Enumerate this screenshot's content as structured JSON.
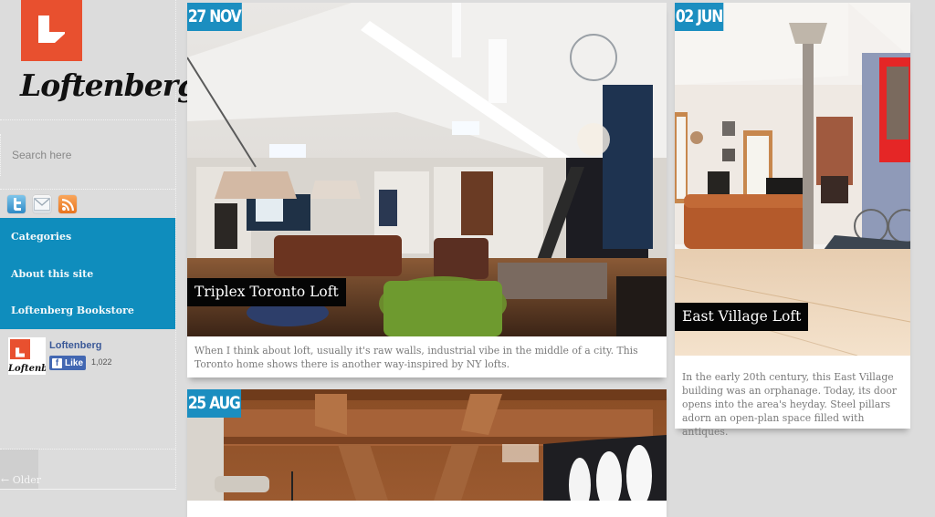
{
  "brand": {
    "name": "Loftenberg",
    "logo_color": "#e8502f",
    "accent_color": "#0f8dbd",
    "date_badge_color": "#1b8ec0"
  },
  "search": {
    "placeholder": "Search here",
    "value": ""
  },
  "social": [
    {
      "name": "twitter",
      "icon": "twitter-icon"
    },
    {
      "name": "email",
      "icon": "mail-icon"
    },
    {
      "name": "rss",
      "icon": "rss-icon"
    }
  ],
  "nav": {
    "items": [
      {
        "label": "Categories"
      },
      {
        "label": "About this site"
      },
      {
        "label": "Loftenberg Bookstore"
      }
    ]
  },
  "facebook": {
    "page_name": "Loftenberg",
    "like_label": "Like",
    "like_count": "1,022",
    "thumb_text": "Loftenberg"
  },
  "pagination": {
    "older_label": "← Older"
  },
  "posts": [
    {
      "date": "27 NOV",
      "title": "Triplex Toronto Loft",
      "excerpt": "When I think about loft, usually it's raw walls, industrial vibe in the middle of a city. This Toronto home shows there is another way-inspired by NY lofts."
    },
    {
      "date": "02 JUN",
      "title": "East Village Loft",
      "excerpt": "In the early 20th century, this East Village building was an orphanage. Today, its door opens into the area's heyday. Steel pillars adorn an open-plan space filled with antiques."
    },
    {
      "date": "25 AUG",
      "title": "",
      "excerpt": ""
    }
  ]
}
